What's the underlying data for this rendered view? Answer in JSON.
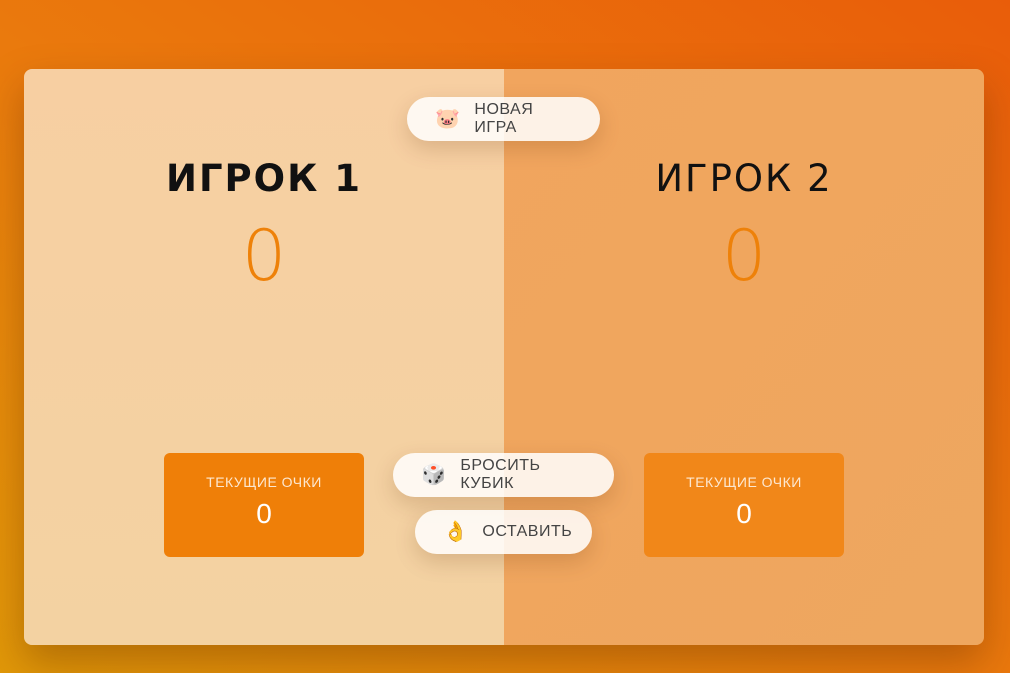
{
  "buttons": {
    "new_game": {
      "icon": "🐷",
      "label": "НОВАЯ ИГРА"
    },
    "roll_dice": {
      "icon": "🎲",
      "label": "БРОСИТЬ КУБИК"
    },
    "hold": {
      "icon": "👌",
      "label": "ОСТАВИТЬ"
    }
  },
  "players": [
    {
      "name": "ИГРОК 1",
      "score": "0",
      "current_label": "ТЕКУЩИЕ ОЧКИ",
      "current_score": "0",
      "active": true
    },
    {
      "name": "ИГРОК 2",
      "score": "0",
      "current_label": "ТЕКУЩИЕ ОЧКИ",
      "current_score": "0",
      "active": false
    }
  ],
  "colors": {
    "accent": "#ee8109",
    "player1_bg": "#f7cfa2",
    "player2_bg": "#f1a55e"
  }
}
